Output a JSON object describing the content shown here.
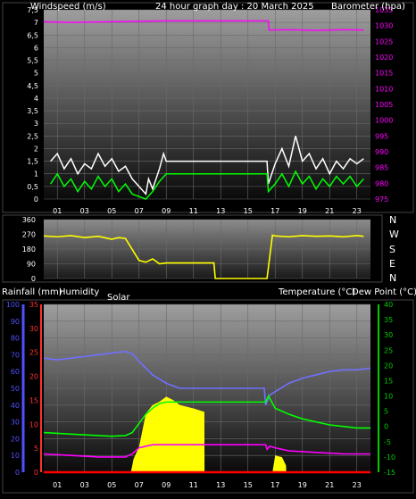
{
  "header": {
    "left_title": "Windspeed (m/s)",
    "center_title": "24 hour graph day : 20 March 2025",
    "right_title": "Barometer (hpa)"
  },
  "wind_dir_axis_labels": [
    "N",
    "W",
    "S",
    "E",
    "N"
  ],
  "bottom_header": {
    "rainfall": "Rainfall (mm)",
    "humidity": "Humidity",
    "solar": "Solar",
    "temperature": "Temperature (°C)",
    "dewpoint": "Dew Point (°C)"
  },
  "colors": {
    "wind_avg": "#00ff00",
    "wind_gust": "#ffffff",
    "barometer": "#ff00ff",
    "wind_dir": "#ffff00",
    "humidity": "#7070ff",
    "rainfall": "#ff0000",
    "solar": "#ffff00",
    "temperature": "#00ff00",
    "dewpoint": "#ff00ff",
    "axis_humidity": "#5050ff",
    "axis_rain": "#ff3030",
    "axis_temp": "#00cc00"
  },
  "chart_data": [
    {
      "type": "line",
      "name": "wind-barometer",
      "x_ticks": [
        "01",
        "03",
        "05",
        "07",
        "09",
        "11",
        "13",
        "15",
        "17",
        "19",
        "21",
        "23"
      ],
      "xlim": [
        0,
        24
      ],
      "ylim_left": [
        0,
        7.5
      ],
      "yticks_left": [
        "0",
        "0,5",
        "1",
        "1,5",
        "2",
        "2,5",
        "3",
        "3,5",
        "4",
        "4,5",
        "5",
        "5,5",
        "6",
        "6,5",
        "7",
        "7,5"
      ],
      "ylim_right": [
        975,
        1035
      ],
      "yticks_right": [
        "975",
        "980",
        "985",
        "990",
        "995",
        "1000",
        "1005",
        "1010",
        "1015",
        "1020",
        "1025",
        "1030",
        "1035"
      ],
      "series": [
        {
          "key": "barometer",
          "axis": "right",
          "x": [
            0,
            2,
            6,
            9,
            12,
            16.5,
            16.55,
            18,
            20,
            22,
            23.5
          ],
          "y": [
            1031.2,
            1031.0,
            1031.3,
            1031.5,
            1031.5,
            1031.5,
            1028.6,
            1028.7,
            1028.5,
            1028.7,
            1028.6
          ]
        },
        {
          "key": "wind_gust",
          "axis": "left",
          "x": [
            0.5,
            1,
            1.5,
            2,
            2.5,
            3,
            3.5,
            4,
            4.5,
            5,
            5.5,
            6,
            6.5,
            7,
            7.5,
            7.7,
            8,
            8.5,
            8.8,
            9,
            12,
            16.4,
            16.5,
            17,
            17.5,
            18,
            18.5,
            19,
            19.5,
            20,
            20.5,
            21,
            21.5,
            22,
            22.5,
            23,
            23.5
          ],
          "y": [
            1.5,
            1.8,
            1.2,
            1.6,
            1.0,
            1.4,
            1.2,
            1.8,
            1.3,
            1.6,
            1.1,
            1.3,
            0.8,
            0.5,
            0.2,
            0.8,
            0.4,
            1.2,
            1.8,
            1.5,
            1.5,
            1.5,
            0.6,
            1.4,
            2.0,
            1.3,
            2.5,
            1.5,
            1.8,
            1.2,
            1.6,
            1.0,
            1.5,
            1.2,
            1.6,
            1.4,
            1.6
          ]
        },
        {
          "key": "wind_avg",
          "axis": "left",
          "x": [
            0.5,
            1,
            1.5,
            2,
            2.5,
            3,
            3.5,
            4,
            4.5,
            5,
            5.5,
            6,
            6.5,
            7,
            7.5,
            8,
            8.5,
            9,
            12,
            16.4,
            16.5,
            17,
            17.5,
            18,
            18.5,
            19,
            19.5,
            20,
            20.5,
            21,
            21.5,
            22,
            22.5,
            23,
            23.5
          ],
          "y": [
            0.6,
            1.0,
            0.5,
            0.8,
            0.3,
            0.7,
            0.4,
            0.9,
            0.5,
            0.8,
            0.3,
            0.6,
            0.2,
            0.1,
            0.0,
            0.3,
            0.7,
            1.0,
            1.0,
            1.0,
            0.3,
            0.6,
            1.0,
            0.5,
            1.1,
            0.6,
            0.9,
            0.4,
            0.8,
            0.5,
            0.9,
            0.6,
            0.9,
            0.5,
            0.8
          ]
        }
      ]
    },
    {
      "type": "line",
      "name": "wind-direction",
      "xlim": [
        0,
        24
      ],
      "ylim": [
        0,
        360
      ],
      "yticks": [
        "0",
        "90",
        "180",
        "270",
        "360"
      ],
      "series": [
        {
          "key": "wind_dir",
          "x": [
            0,
            1,
            2,
            3,
            4,
            5,
            5.5,
            6,
            7,
            7.5,
            8,
            8.5,
            9,
            10,
            11,
            12.5,
            12.6,
            14,
            15.5,
            16.4,
            16.8,
            17,
            18,
            19,
            20,
            21,
            22,
            23,
            23.5
          ],
          "y": [
            260,
            255,
            262,
            250,
            258,
            240,
            250,
            245,
            110,
            100,
            120,
            90,
            95,
            95,
            95,
            95,
            0,
            0,
            0,
            0,
            265,
            260,
            255,
            262,
            258,
            260,
            255,
            262,
            258
          ]
        }
      ]
    },
    {
      "type": "line",
      "name": "climate",
      "xlim": [
        0,
        24
      ],
      "ylim_humidity": [
        0,
        100
      ],
      "yticks_humidity": [
        "0",
        "10",
        "20",
        "30",
        "40",
        "50",
        "60",
        "70",
        "80",
        "90",
        "100"
      ],
      "ylim_rain": [
        0,
        35
      ],
      "yticks_rain": [
        "0",
        "5",
        "10",
        "15",
        "20",
        "25",
        "30",
        "35"
      ],
      "ylim_temp": [
        -15,
        40
      ],
      "yticks_temp": [
        "-15",
        "-10",
        "-5",
        "0",
        "5",
        "10",
        "15",
        "20",
        "25",
        "30",
        "35",
        "40"
      ],
      "series": [
        {
          "key": "humidity",
          "axis": "humidity",
          "x": [
            0,
            1,
            2,
            3,
            4,
            5,
            6,
            6.6,
            7,
            8,
            9,
            10,
            12,
            16.2,
            16.3,
            16.6,
            17,
            18,
            19,
            20,
            21,
            22,
            23,
            24
          ],
          "y": [
            68,
            67,
            68,
            69,
            70,
            71,
            72,
            70,
            66,
            58,
            53,
            50,
            50,
            50,
            40,
            46,
            48,
            53,
            56,
            58,
            60,
            61,
            61,
            62
          ]
        },
        {
          "key": "temperature",
          "axis": "temp",
          "x": [
            0,
            2,
            4,
            5,
            6,
            6.5,
            7,
            7.5,
            8,
            8.5,
            9,
            10,
            12,
            16.3,
            16.5,
            17,
            18,
            19,
            20,
            21,
            22,
            23,
            24
          ],
          "y": [
            -2,
            -2.5,
            -3,
            -3.2,
            -3,
            -2,
            1,
            4,
            6,
            7.5,
            8,
            8,
            8,
            8,
            10,
            6,
            4,
            2.5,
            1.5,
            0.5,
            0,
            -0.5,
            -0.5
          ]
        },
        {
          "key": "dewpoint",
          "axis": "temp",
          "x": [
            0,
            2,
            4,
            6,
            6.5,
            7,
            7.5,
            8,
            8.5,
            9,
            10,
            12,
            16.3,
            16.4,
            16.6,
            17,
            18,
            20,
            22,
            24
          ],
          "y": [
            -9,
            -9.5,
            -10,
            -10,
            -9,
            -7,
            -6.5,
            -6,
            -6,
            -6,
            -6,
            -6,
            -6,
            -7.5,
            -6.5,
            -7,
            -8,
            -8.5,
            -9,
            -9
          ]
        },
        {
          "key": "rainfall",
          "axis": "rain",
          "x": [
            0,
            24
          ],
          "y": [
            0,
            0
          ]
        },
        {
          "key": "solar",
          "axis": "humidity",
          "type": "area",
          "x": [
            6.4,
            6.6,
            7,
            7.5,
            8,
            8.5,
            9,
            9.5,
            10,
            11,
            11.8,
            11.81,
            16.8,
            17,
            17.5,
            17.8,
            17.81
          ],
          "y": [
            0,
            8,
            15,
            35,
            40,
            42,
            45,
            43,
            40,
            38,
            36,
            0,
            0,
            10,
            9,
            4,
            0
          ]
        }
      ]
    }
  ]
}
